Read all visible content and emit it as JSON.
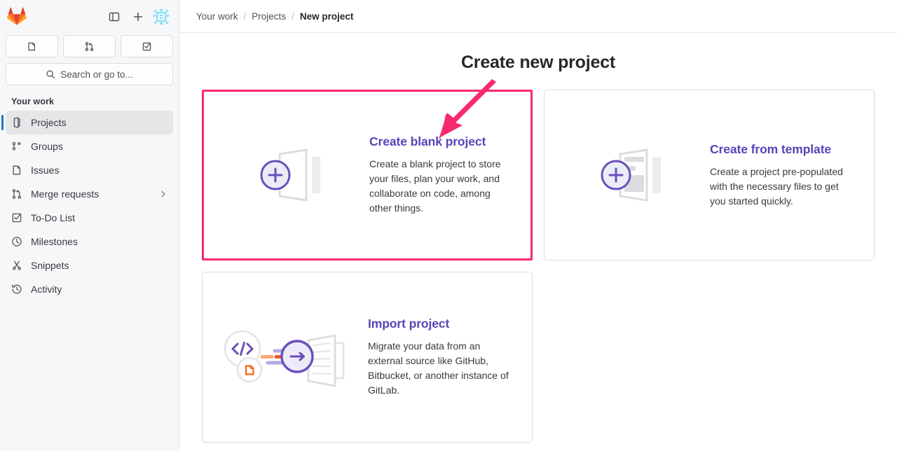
{
  "sidebar": {
    "logo_icon": "gitlab-tanuki-logo",
    "top_actions": [
      {
        "name": "toggle-sidebar-button",
        "icon": "sidebar-panel-icon",
        "label": "Primary navigation sidebar"
      },
      {
        "name": "create-new-button",
        "icon": "plus-icon",
        "label": "Create new..."
      },
      {
        "name": "user-avatar",
        "icon": "avatar-identicon",
        "label": "User menu"
      }
    ],
    "quick_buttons": [
      {
        "name": "quick-issues-button",
        "icon": "issues-icon",
        "label": "Issues"
      },
      {
        "name": "quick-merge-requests-button",
        "icon": "merge-request-icon",
        "label": "Merge requests"
      },
      {
        "name": "quick-todos-button",
        "icon": "todo-checkbox-icon",
        "label": "To-Do List"
      }
    ],
    "search": {
      "icon": "search-icon",
      "label": "Search or go to..."
    },
    "section_title": "Your work",
    "items": [
      {
        "label": "Projects",
        "icon": "project-icon",
        "active": true,
        "chevron": false
      },
      {
        "label": "Groups",
        "icon": "group-icon",
        "active": false,
        "chevron": false
      },
      {
        "label": "Issues",
        "icon": "issues-icon",
        "active": false,
        "chevron": false
      },
      {
        "label": "Merge requests",
        "icon": "merge-request-icon",
        "active": false,
        "chevron": true
      },
      {
        "label": "To-Do List",
        "icon": "todo-checkbox-icon",
        "active": false,
        "chevron": false
      },
      {
        "label": "Milestones",
        "icon": "clock-icon",
        "active": false,
        "chevron": false
      },
      {
        "label": "Snippets",
        "icon": "snippet-scissors-icon",
        "active": false,
        "chevron": false
      },
      {
        "label": "Activity",
        "icon": "history-icon",
        "active": false,
        "chevron": false
      }
    ]
  },
  "breadcrumb": {
    "items": [
      {
        "label": "Your work",
        "current": false
      },
      {
        "label": "Projects",
        "current": false
      },
      {
        "label": "New project",
        "current": true
      }
    ],
    "separator": "/"
  },
  "main": {
    "page_title": "Create new project",
    "cards": [
      {
        "id": "create-blank-project",
        "title": "Create blank project",
        "description": "Create a blank project to store your files, plan your work, and collaborate on code, among other things.",
        "illustration": "blank-project-illustration",
        "highlighted": true
      },
      {
        "id": "create-from-template",
        "title": "Create from template",
        "description": "Create a project pre-populated with the necessary files to get you started quickly.",
        "illustration": "template-project-illustration",
        "highlighted": false
      },
      {
        "id": "import-project",
        "title": "Import project",
        "description": "Migrate your data from an external source like GitHub, Bitbucket, or another instance of GitLab.",
        "illustration": "import-project-illustration",
        "highlighted": false
      }
    ]
  },
  "annotation": {
    "type": "arrow",
    "name": "highlight-arrow-annotation",
    "color": "#f72a6d",
    "points_to": "create-blank-project"
  },
  "colors": {
    "brand_purple": "#5943b6",
    "accent_pink": "#f72a6d",
    "active_blue": "#1f75cb",
    "sidebar_bg": "#f6f7f8",
    "text_primary": "#28272d",
    "text_secondary": "#535158",
    "border": "#dcdcde"
  }
}
